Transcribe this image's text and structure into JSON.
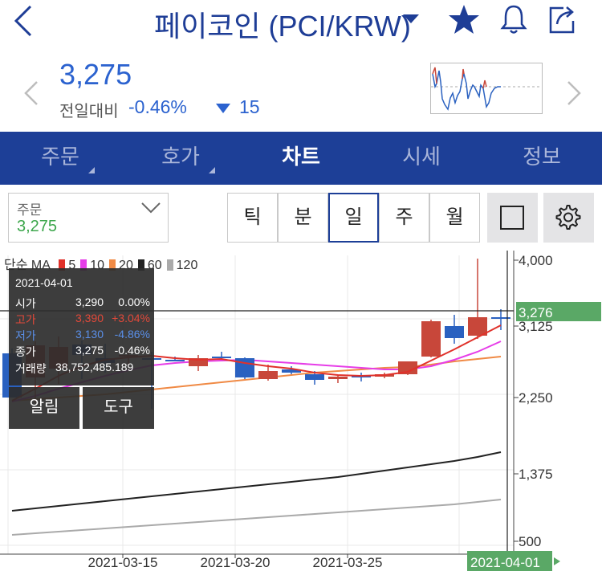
{
  "header": {
    "title": "페이코인 (PCI/KRW)"
  },
  "quote": {
    "price": "3,275",
    "change_label": "전일대비",
    "change_pct": "-0.46%",
    "change_amt": "15",
    "down_color": "#2b62cf"
  },
  "tabs": [
    {
      "label": "주문",
      "active": false,
      "corner": true
    },
    {
      "label": "호가",
      "active": false,
      "corner": true
    },
    {
      "label": "차트",
      "active": true,
      "corner": false
    },
    {
      "label": "시세",
      "active": false,
      "corner": false
    },
    {
      "label": "정보",
      "active": false,
      "corner": false
    }
  ],
  "order_select": {
    "label": "주문",
    "value": "3,275"
  },
  "periods": [
    "틱",
    "분",
    "일",
    "주",
    "월"
  ],
  "active_period": "일",
  "info": {
    "date": "2021-04-01",
    "rows": [
      {
        "label": "시가",
        "value": "3,290",
        "pct": "0.00%",
        "color": "#ffffff"
      },
      {
        "label": "고가",
        "value": "3,390",
        "pct": "+3.04%",
        "color": "#e2493a"
      },
      {
        "label": "저가",
        "value": "3,130",
        "pct": "-4.86%",
        "color": "#5a8fe8"
      },
      {
        "label": "종가",
        "value": "3,275",
        "pct": "-0.46%",
        "color": "#ffffff"
      }
    ],
    "volume_label": "거래량",
    "volume": "38,752,485.189"
  },
  "info_buttons": {
    "alarm": "알림",
    "tools": "도구"
  },
  "legend": {
    "type_label": "단순 MA",
    "items": [
      {
        "period": "5",
        "color": "#e0312a"
      },
      {
        "period": "10",
        "color": "#e63de8"
      },
      {
        "period": "20",
        "color": "#f08a45"
      },
      {
        "period": "60",
        "color": "#222222"
      },
      {
        "period": "120",
        "color": "#aaaaaa"
      }
    ]
  },
  "chart_data": {
    "type": "candlestick",
    "y_ticks": [
      "4,000",
      "3,125",
      "2,250",
      "1,375",
      "500"
    ],
    "ylim": [
      500,
      4000
    ],
    "x_ticks": [
      "2021-03-15",
      "2021-03-20",
      "2021-03-25"
    ],
    "crosshair_date": "2021-04-01",
    "crosshair_price": "3,276",
    "candles": [
      {
        "o": 2840,
        "h": 2900,
        "l": 2290,
        "c": 2290
      },
      {
        "o": 2540,
        "h": 2990,
        "l": 2220,
        "c": 2940
      },
      {
        "o": 2650,
        "h": 3050,
        "l": 2460,
        "c": 2920
      },
      {
        "o": 2950,
        "h": 3000,
        "l": 2520,
        "c": 2820
      },
      {
        "o": 2780,
        "h": 2960,
        "l": 2600,
        "c": 2720
      },
      {
        "o": 2820,
        "h": 2900,
        "l": 2700,
        "c": 2820
      },
      {
        "o": 2780,
        "h": 2860,
        "l": 2150,
        "c": 2770
      },
      {
        "o": 2760,
        "h": 2800,
        "l": 2740,
        "c": 2740
      },
      {
        "o": 2680,
        "h": 2820,
        "l": 2620,
        "c": 2780
      },
      {
        "o": 2800,
        "h": 2860,
        "l": 2760,
        "c": 2780
      },
      {
        "o": 2780,
        "h": 2790,
        "l": 2520,
        "c": 2540
      },
      {
        "o": 2520,
        "h": 2700,
        "l": 2500,
        "c": 2620
      },
      {
        "o": 2640,
        "h": 2680,
        "l": 2580,
        "c": 2600
      },
      {
        "o": 2580,
        "h": 2620,
        "l": 2450,
        "c": 2510
      },
      {
        "o": 2520,
        "h": 2560,
        "l": 2470,
        "c": 2550
      },
      {
        "o": 2560,
        "h": 2600,
        "l": 2490,
        "c": 2540
      },
      {
        "o": 2550,
        "h": 2600,
        "l": 2530,
        "c": 2580
      },
      {
        "o": 2580,
        "h": 2740,
        "l": 2570,
        "c": 2740
      },
      {
        "o": 2800,
        "h": 3260,
        "l": 2790,
        "c": 3240
      },
      {
        "o": 3180,
        "h": 3320,
        "l": 2960,
        "c": 3030
      },
      {
        "o": 3060,
        "h": 4020,
        "l": 3020,
        "c": 3290
      },
      {
        "o": 3290,
        "h": 3390,
        "l": 3130,
        "c": 3275
      }
    ],
    "series": [
      {
        "name": "5",
        "values": [
          2250,
          2400,
          2560,
          2680,
          2760,
          2790,
          2810,
          2780,
          2760,
          2770,
          2720,
          2680,
          2650,
          2600,
          2570,
          2560,
          2570,
          2610,
          2750,
          2890,
          3040,
          3190
        ]
      },
      {
        "name": "10",
        "values": [
          2240,
          2310,
          2400,
          2480,
          2560,
          2630,
          2690,
          2720,
          2740,
          2750,
          2760,
          2740,
          2720,
          2700,
          2680,
          2660,
          2640,
          2640,
          2680,
          2760,
          2860,
          2990
        ]
      },
      {
        "name": "20",
        "values": [
          2250,
          2270,
          2290,
          2310,
          2330,
          2360,
          2390,
          2420,
          2450,
          2480,
          2510,
          2540,
          2570,
          2600,
          2620,
          2640,
          2660,
          2670,
          2700,
          2740,
          2770,
          2800
        ]
      },
      {
        "name": "60",
        "values": [
          880,
          910,
          940,
          970,
          1000,
          1030,
          1060,
          1090,
          1120,
          1150,
          1180,
          1210,
          1240,
          1270,
          1300,
          1340,
          1380,
          1420,
          1460,
          1500,
          1550,
          1610
        ]
      },
      {
        "name": "120",
        "values": [
          580,
          600,
          620,
          640,
          660,
          680,
          700,
          720,
          740,
          760,
          780,
          800,
          820,
          840,
          860,
          880,
          900,
          920,
          940,
          960,
          990,
          1020
        ]
      }
    ],
    "up_color": "#c8473a",
    "down_color": "#2a61c0"
  }
}
